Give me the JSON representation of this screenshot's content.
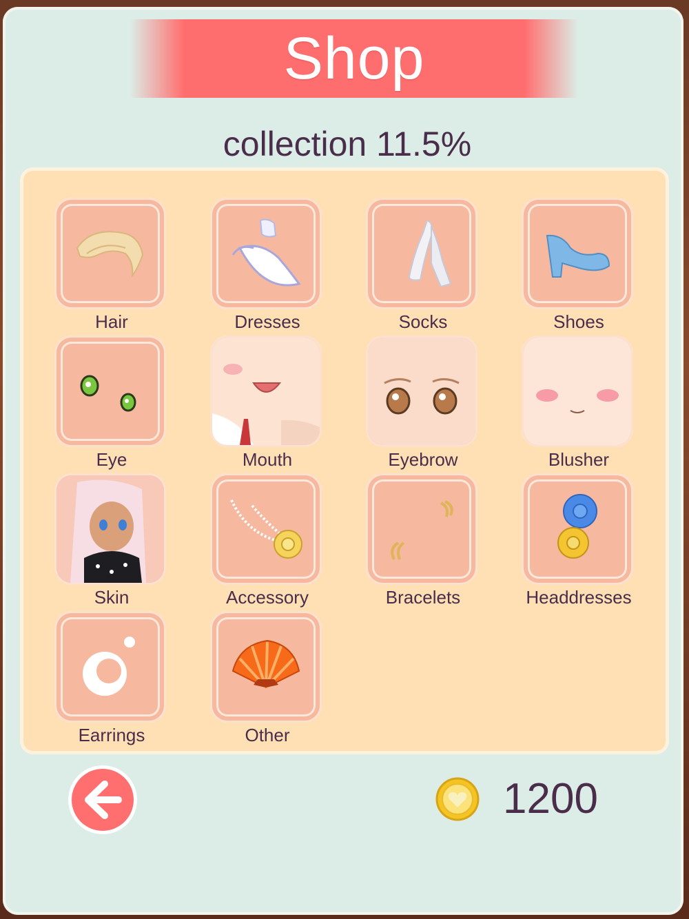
{
  "header": {
    "title": "Shop"
  },
  "collection": {
    "text": "collection 11.5%"
  },
  "categories": [
    {
      "label": "Hair",
      "icon": "hair-icon"
    },
    {
      "label": "Dresses",
      "icon": "dress-icon"
    },
    {
      "label": "Socks",
      "icon": "socks-icon"
    },
    {
      "label": "Shoes",
      "icon": "shoe-icon"
    },
    {
      "label": "Eye",
      "icon": "eye-icon"
    },
    {
      "label": "Mouth",
      "icon": "mouth-icon"
    },
    {
      "label": "Eyebrow",
      "icon": "eyebrow-icon"
    },
    {
      "label": "Blusher",
      "icon": "blusher-icon"
    },
    {
      "label": "Skin",
      "icon": "skin-icon"
    },
    {
      "label": "Accessory",
      "icon": "necklace-icon"
    },
    {
      "label": "Bracelets",
      "icon": "bracelet-icon"
    },
    {
      "label": "Headdresses",
      "icon": "rose-icon"
    },
    {
      "label": "Earrings",
      "icon": "earring-icon"
    },
    {
      "label": "Other",
      "icon": "fan-icon"
    }
  ],
  "footer": {
    "coins": "1200",
    "back_icon": "arrow-left-icon",
    "coin_icon": "coin-heart-icon"
  },
  "colors": {
    "accent": "#ff6e6e",
    "panel": "#dcece6",
    "grid": "#ffe0b4",
    "tile": "#f7b8a0",
    "text": "#4a2d4b"
  }
}
